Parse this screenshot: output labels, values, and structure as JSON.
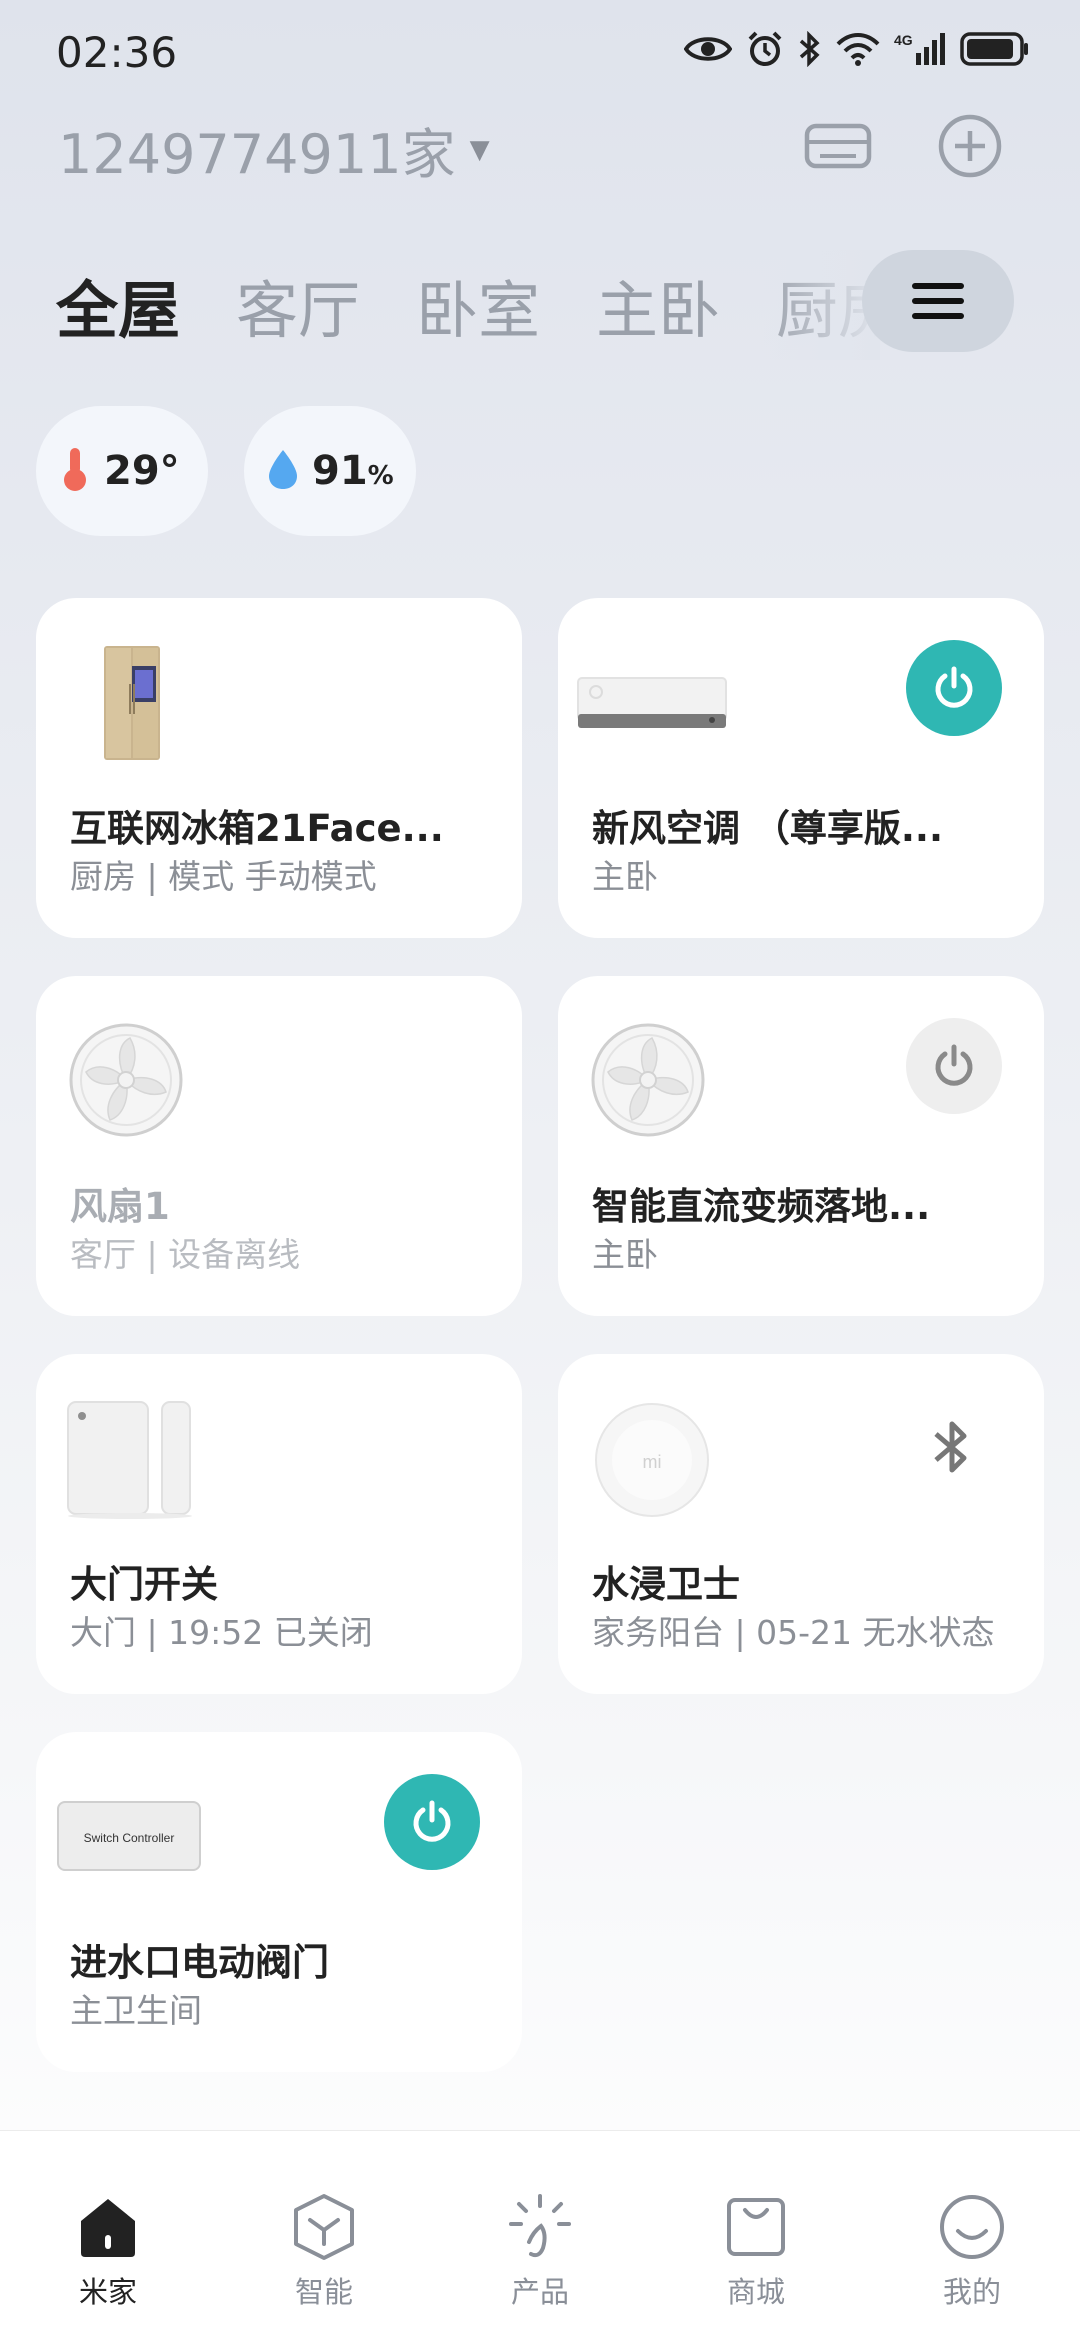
{
  "status_bar": {
    "time": "02:36",
    "icons": [
      "eye-icon",
      "alarm-icon",
      "bluetooth-icon",
      "wifi-icon",
      "signal-4g-icon",
      "battery-icon"
    ],
    "network": "4G"
  },
  "header": {
    "home_name": "1249774911家",
    "icons": [
      "card-icon",
      "add-circle-icon"
    ]
  },
  "tabs": [
    {
      "label": "全屋",
      "active": true
    },
    {
      "label": "客厅",
      "active": false
    },
    {
      "label": "卧室",
      "active": false
    },
    {
      "label": "主卧",
      "active": false
    },
    {
      "label": "厨房",
      "active": false
    }
  ],
  "env": {
    "temperature": {
      "value": "29",
      "unit": "°"
    },
    "humidity": {
      "value": "91",
      "unit": "%"
    }
  },
  "devices": [
    {
      "name": "互联网冰箱21Face...",
      "sub": "厨房 | 模式 手动模式",
      "control": "none",
      "icon": "fridge-icon"
    },
    {
      "name": "新风空调 （尊享版...",
      "sub": "主卧",
      "control": "power-on",
      "icon": "air-conditioner-icon"
    },
    {
      "name": "风扇1",
      "sub": "客厅 | 设备离线",
      "control": "none",
      "icon": "fan-icon",
      "offline": true
    },
    {
      "name": "智能直流变频落地...",
      "sub": "主卧",
      "control": "power-off",
      "icon": "fan-icon"
    },
    {
      "name": "大门开关",
      "sub": "大门 | 19:52 已关闭",
      "control": "none",
      "icon": "door-sensor-icon"
    },
    {
      "name": "水浸卫士",
      "sub": "家务阳台 | 05-21 无水状态",
      "control": "bluetooth",
      "icon": "water-sensor-icon",
      "thumb_text": "mi"
    },
    {
      "name": "进水口电动阀门",
      "sub": "主卫生间",
      "control": "power-on",
      "icon": "switch-controller-icon",
      "thumb_text": "Switch Controller"
    }
  ],
  "bottom_nav": [
    {
      "label": "米家",
      "icon": "home-icon",
      "active": true
    },
    {
      "label": "智能",
      "icon": "smart-cube-icon",
      "active": false
    },
    {
      "label": "产品",
      "icon": "product-sparkle-icon",
      "active": false
    },
    {
      "label": "商城",
      "icon": "shopping-bag-icon",
      "active": false
    },
    {
      "label": "我的",
      "icon": "smile-icon",
      "active": false
    }
  ],
  "colors": {
    "accent": "#2fb7b3",
    "temperature": "#f06a5a",
    "humidity": "#55a8f0",
    "text_primary": "#222222",
    "text_secondary": "#8b8f96"
  }
}
